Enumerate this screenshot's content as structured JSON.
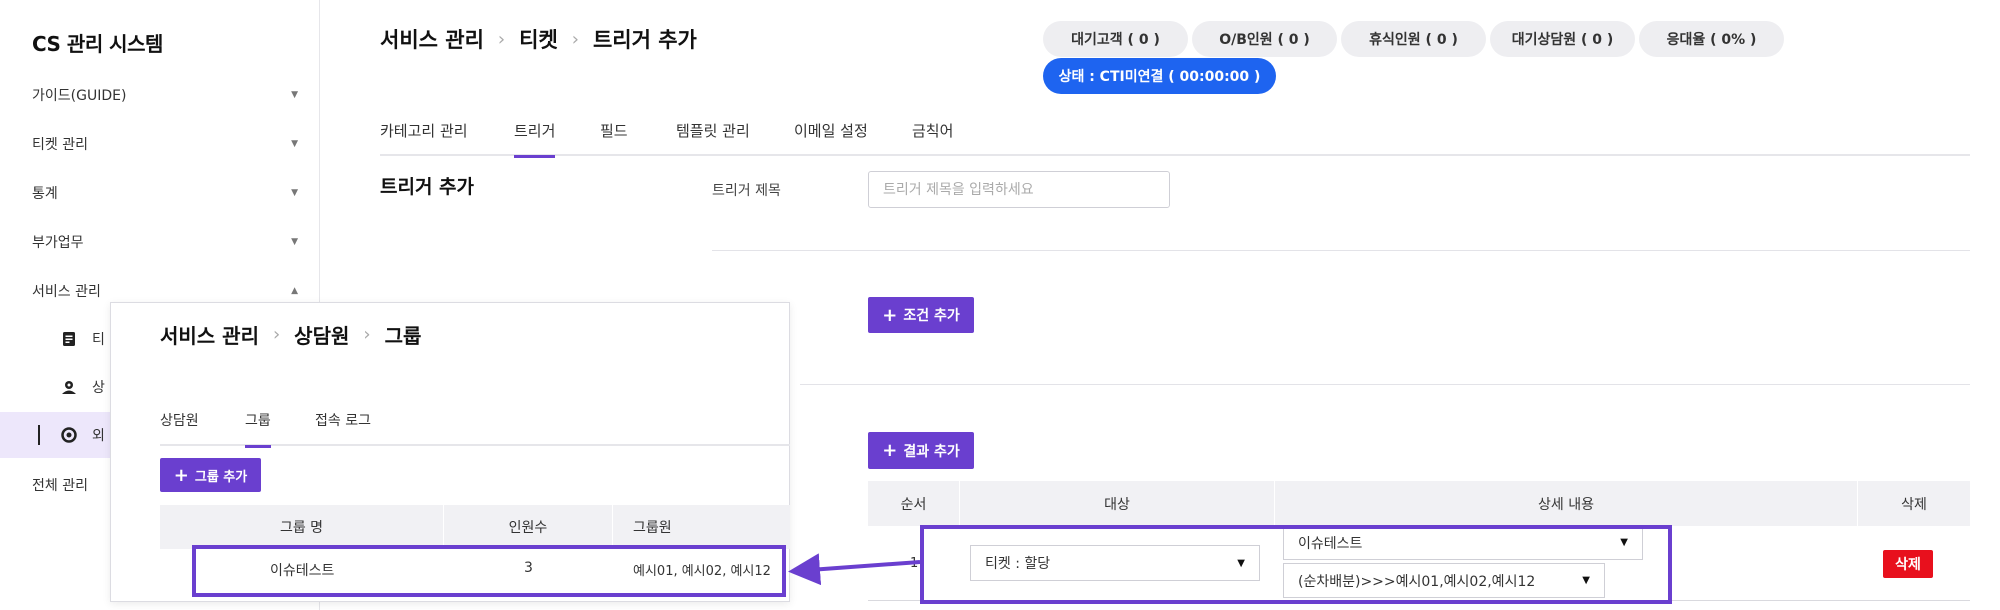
{
  "sidebar": {
    "brand": "CS 관리 시스템",
    "items": [
      {
        "label": "가이드(GUIDE)"
      },
      {
        "label": "티켓 관리"
      },
      {
        "label": "통계"
      },
      {
        "label": "부가업무"
      },
      {
        "label": "서비스 관리"
      },
      {
        "label": "전체 관리"
      }
    ],
    "sub_items": [
      {
        "label": "티",
        "icon": "document-icon"
      },
      {
        "label": "상",
        "icon": "agent-icon"
      },
      {
        "label": "외",
        "icon": "gear-user-icon"
      }
    ]
  },
  "header": {
    "breadcrumb": [
      "서비스 관리",
      "티켓",
      "트리거 추가"
    ],
    "stats": [
      "대기고객 ( 0 )",
      "O/B인원 ( 0 )",
      "휴식인원 ( 0 )",
      "대기상담원 ( 0 )",
      "응대율 ( 0% )"
    ],
    "status": "상태 : CTI미연결 ( 00:00:00 )",
    "status_color": "#1e64f0"
  },
  "tabs": [
    "카테고리 관리",
    "트리거",
    "필드",
    "템플릿 관리",
    "이메일 설정",
    "금칙어"
  ],
  "form": {
    "section_title": "트리거 추가",
    "title_label": "트리거 제목",
    "title_placeholder": "트리거 제목을 입력하세요",
    "add_condition": "조건 추가",
    "add_result": "결과 추가"
  },
  "result_table": {
    "headers": [
      "순서",
      "대상",
      "상세 내용",
      "삭제"
    ],
    "row": {
      "order": "1",
      "target": "티켓 : 할당",
      "detail_group": "이슈테스트",
      "detail_method": "(순차배분)>>>예시01,예시02,예시12",
      "delete": "삭제"
    }
  },
  "popup": {
    "breadcrumb": [
      "서비스 관리",
      "상담원",
      "그룹"
    ],
    "tabs": [
      "상담원",
      "그룹",
      "접속 로그"
    ],
    "add_group": "그룹 추가",
    "headers": [
      "그룹 명",
      "인원수",
      "그룹원"
    ],
    "row": {
      "name": "이슈테스트",
      "count": "3",
      "members": "예시01, 예시02, 예시12"
    }
  },
  "colors": {
    "accent": "#6a3fcf",
    "delete": "#e8101d"
  }
}
